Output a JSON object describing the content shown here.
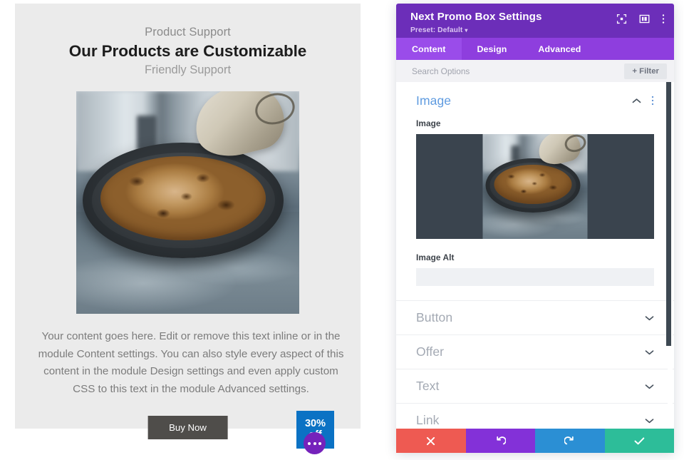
{
  "preview": {
    "promo": {
      "subtitle_top": "Product Support",
      "title": "Our Products are Customizable",
      "subtitle_bottom": "Friendly Support",
      "body": "Your content goes here. Edit or remove this text inline or in the module Content settings. You can also style every aspect of this content in the module Design settings and even apply custom CSS to this text in the module Advanced settings.",
      "button_label": "Buy Now",
      "offer_line1": "30%",
      "offer_line2": "off",
      "image_alt_description": "Pizza on a dark pan held with an oven mitt on a stone counter"
    },
    "module_menu_icon": "ellipsis-icon",
    "colors": {
      "box_background": "#ebebeb",
      "button_background": "#4f4d4a",
      "offer_badge_background": "#0b72c4",
      "module_menu_background": "#7522bb"
    }
  },
  "settings": {
    "header": {
      "title": "Next Promo Box Settings",
      "preset_label": "Preset: Default",
      "preset_caret": "▾",
      "icons": [
        {
          "name": "focus-target-icon"
        },
        {
          "name": "layout-split-icon"
        },
        {
          "name": "kebab-menu-icon"
        }
      ],
      "background_color": "#6c2eb9"
    },
    "tabs": [
      {
        "label": "Content",
        "active": true
      },
      {
        "label": "Design",
        "active": false
      },
      {
        "label": "Advanced",
        "active": false
      }
    ],
    "search": {
      "value": "",
      "placeholder": "Search Options",
      "filter_label": "+ Filter"
    },
    "image_section": {
      "title": "Image",
      "expanded": true,
      "collapse_icon": "chevron-up-icon",
      "menu_icon": "kebab-menu-icon",
      "image_field_label": "Image",
      "image_alt_label": "Image Alt",
      "image_alt_value": "",
      "image_alt_placeholder": ""
    },
    "accordions": [
      {
        "label": "Button",
        "icon": "chevron-down-icon"
      },
      {
        "label": "Offer",
        "icon": "chevron-down-icon"
      },
      {
        "label": "Text",
        "icon": "chevron-down-icon"
      },
      {
        "label": "Link",
        "icon": "chevron-down-icon"
      }
    ],
    "footer": [
      {
        "name": "cancel-button",
        "icon": "close-x-icon",
        "color": "#ee5a52"
      },
      {
        "name": "undo-button",
        "icon": "undo-arrow-icon",
        "color": "#8331d8"
      },
      {
        "name": "redo-button",
        "icon": "redo-arrow-icon",
        "color": "#2b8fd4"
      },
      {
        "name": "save-button",
        "icon": "checkmark-icon",
        "color": "#2dbd99"
      }
    ]
  }
}
